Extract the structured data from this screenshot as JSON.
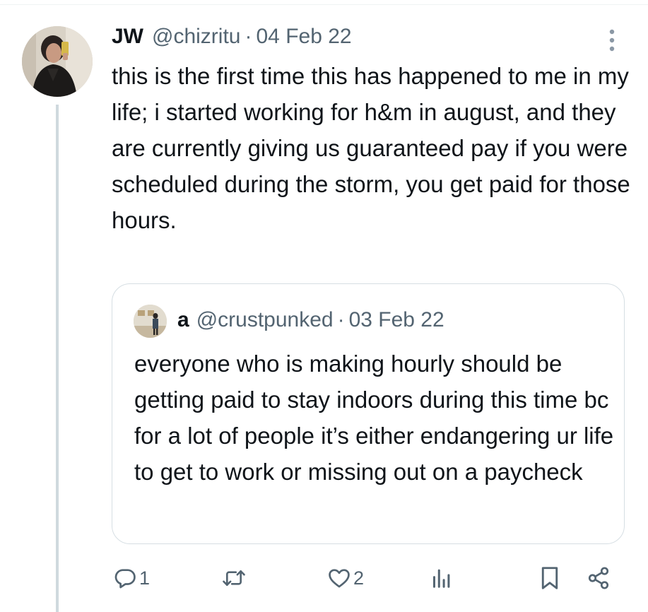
{
  "tweet": {
    "display_name": "JW",
    "handle": "@chizritu",
    "separator": "·",
    "date": "04 Feb 22",
    "text": "this is the first time this has happened to me in my life; i started working for h&m in august, and they are currently giving us guaranteed pay if you were scheduled during the storm, you get paid for those hours."
  },
  "quoted_tweet": {
    "display_name": "a",
    "handle": "@crustpunked",
    "separator": "·",
    "date": "03 Feb 22",
    "text": "everyone who is making hourly should be getting paid to stay indoors during this time bc for a lot of people it’s either endangering ur life to get to work or missing out on a paycheck"
  },
  "actions": {
    "reply_count": "1",
    "retweet_count": "",
    "like_count": "2",
    "views_count": ""
  },
  "icons": {
    "more": "more-vertical-icon",
    "reply": "reply-icon",
    "retweet": "retweet-icon",
    "like": "heart-icon",
    "views": "views-icon",
    "bookmark": "bookmark-icon",
    "share": "share-icon"
  },
  "colors": {
    "text": "#0f1419",
    "secondary": "#536471",
    "border": "#d6dee3",
    "thread_line": "#cfd9de"
  }
}
